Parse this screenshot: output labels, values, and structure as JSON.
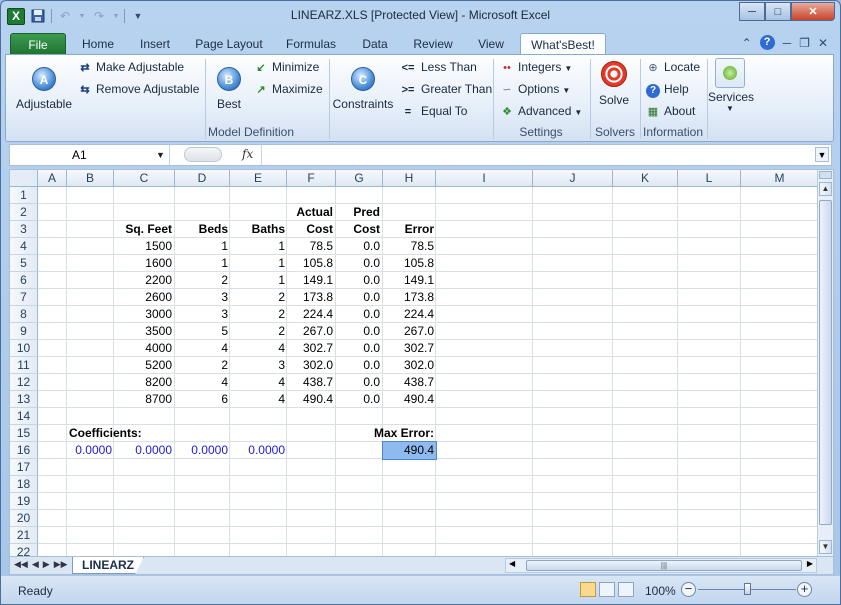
{
  "window": {
    "title": "LINEARZ.XLS  [Protected View]  -  Microsoft Excel",
    "app_icon_letter": "X"
  },
  "tabs": [
    "File",
    "Home",
    "Insert",
    "Page Layout",
    "Formulas",
    "Data",
    "Review",
    "View",
    "What'sBest!"
  ],
  "ribbon": {
    "adjustable": "Adjustable",
    "make_adjustable": "Make Adjustable",
    "remove_adjustable": "Remove Adjustable",
    "best": "Best",
    "minimize": "Minimize",
    "maximize": "Maximize",
    "constraints": "Constraints",
    "less_than": "Less Than",
    "greater_than": "Greater Than",
    "equal_to": "Equal To",
    "integers": "Integers",
    "options": "Options",
    "advanced": "Advanced",
    "solve": "Solve",
    "locate": "Locate",
    "help": "Help",
    "about": "About",
    "services": "Services",
    "groups": {
      "model_definition": "Model Definition",
      "settings": "Settings",
      "solvers": "Solvers",
      "information": "Information"
    },
    "icon_letters": {
      "adjustable": "A",
      "best": "B",
      "constraints": "C"
    },
    "symbols": {
      "less_than": "<=",
      "greater_than": ">=",
      "equal_to": "="
    }
  },
  "formula_bar": {
    "name_box": "A1",
    "fx_label": "fx",
    "formula": ""
  },
  "grid": {
    "columns": [
      "A",
      "B",
      "C",
      "D",
      "E",
      "F",
      "G",
      "H",
      "I",
      "J",
      "K",
      "L",
      "M"
    ],
    "rows": [
      "1",
      "2",
      "3",
      "4",
      "5",
      "6",
      "7",
      "8",
      "9",
      "10",
      "11",
      "12",
      "13",
      "14",
      "15",
      "16",
      "17",
      "18",
      "19",
      "20",
      "21",
      "22"
    ],
    "header_row2": {
      "actual": "Actual",
      "pred": "Pred"
    },
    "header_row3": {
      "sqfeet": "Sq. Feet",
      "beds": "Beds",
      "baths": "Baths",
      "cost_f": "Cost",
      "cost_g": "Cost",
      "error": "Error"
    },
    "data_rows": [
      {
        "sqfeet": "1500",
        "beds": "1",
        "baths": "1",
        "actual": "78.5",
        "pred": "0.0",
        "error": "78.5"
      },
      {
        "sqfeet": "1600",
        "beds": "1",
        "baths": "1",
        "actual": "105.8",
        "pred": "0.0",
        "error": "105.8"
      },
      {
        "sqfeet": "2200",
        "beds": "2",
        "baths": "1",
        "actual": "149.1",
        "pred": "0.0",
        "error": "149.1"
      },
      {
        "sqfeet": "2600",
        "beds": "3",
        "baths": "2",
        "actual": "173.8",
        "pred": "0.0",
        "error": "173.8"
      },
      {
        "sqfeet": "3000",
        "beds": "3",
        "baths": "2",
        "actual": "224.4",
        "pred": "0.0",
        "error": "224.4"
      },
      {
        "sqfeet": "3500",
        "beds": "5",
        "baths": "2",
        "actual": "267.0",
        "pred": "0.0",
        "error": "267.0"
      },
      {
        "sqfeet": "4000",
        "beds": "4",
        "baths": "4",
        "actual": "302.7",
        "pred": "0.0",
        "error": "302.7"
      },
      {
        "sqfeet": "5200",
        "beds": "2",
        "baths": "3",
        "actual": "302.0",
        "pred": "0.0",
        "error": "302.0"
      },
      {
        "sqfeet": "8200",
        "beds": "4",
        "baths": "4",
        "actual": "438.7",
        "pred": "0.0",
        "error": "438.7"
      },
      {
        "sqfeet": "8700",
        "beds": "6",
        "baths": "4",
        "actual": "490.4",
        "pred": "0.0",
        "error": "490.4"
      }
    ],
    "coefficients_label": "Coefficients:",
    "coefficients": [
      "0.0000",
      "0.0000",
      "0.0000",
      "0.0000"
    ],
    "max_error_label": "Max Error:",
    "max_error_value": "490.4"
  },
  "sheet_tab": "LINEARZ",
  "status": {
    "ready": "Ready",
    "zoom": "100%"
  },
  "colors": {
    "file_tab": "#2a8a40",
    "coef_blue": "#1a1ad8",
    "selected_cell": "#8fbaf0"
  }
}
